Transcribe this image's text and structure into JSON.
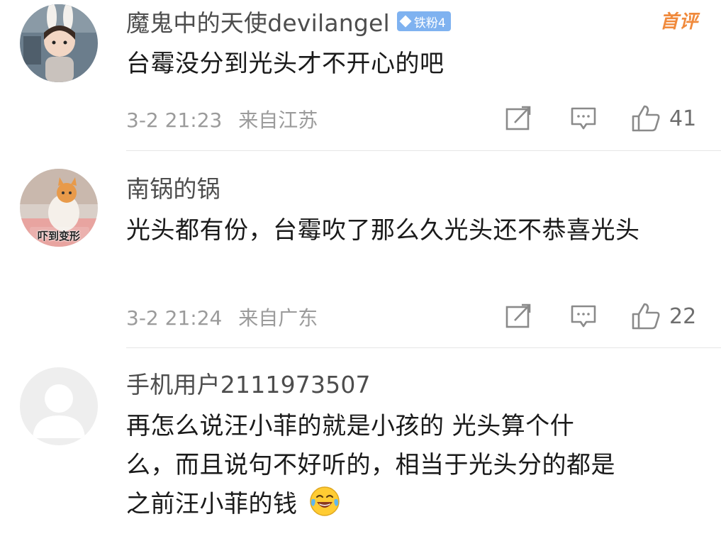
{
  "comments": [
    {
      "username": "魔鬼中的天使devilangel",
      "fan_badge": "铁粉4",
      "hot_tag": "首评",
      "text": "台霉没分到光头才不开心的吧",
      "time": "3-2 21:23",
      "location": "来自江苏",
      "likes": "41"
    },
    {
      "username": "南锅的锅",
      "avatar_caption": "吓到变形",
      "text": "光头都有份，台霉吹了那么久光头还不恭喜光头",
      "time": "3-2 21:24",
      "location": "来自广东",
      "likes": "22"
    },
    {
      "username": "手机用户2111973507",
      "text_lines": [
        "再怎么说汪小菲的就是小孩的 光头算个什",
        "么，而且说句不好听的，相当于光头分的都是",
        "之前汪小菲的钱"
      ],
      "emoji": "laughing-tears-emoji"
    }
  ],
  "icons": {
    "repost": "repost-icon",
    "comment": "comment-icon",
    "like": "thumbs-up-icon"
  },
  "colors": {
    "username": "#4d4d4d",
    "meta": "#9b9b9b",
    "hot_tag": "#f08a3c",
    "fan_badge": "#7fb2f0"
  }
}
